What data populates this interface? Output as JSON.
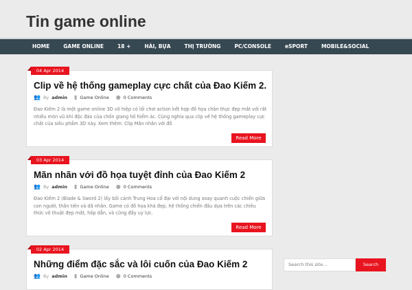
{
  "site_title": "Tin game online",
  "nav": [
    "HOME",
    "GAME ONLINE",
    "18 +",
    "HÀI, BỰA",
    "THỊ TRƯỜNG",
    "PC/CONSOLE",
    "eSPORT",
    "MOBILE&SOCIAL"
  ],
  "posts": [
    {
      "date": "04 Apr 2014",
      "title": "Clip về hệ thống gameplay cực chất của Đao Kiếm 2.",
      "by": "By",
      "author": "admin",
      "category": "Game Online",
      "comments": "0 Comments",
      "excerpt": "Đao Kiếm 2 là một game online 3D võ hiệp có lối chơi action kết hợp đồ họa chân thực đẹp mắt với rất nhiều món vũ khí độc đáo của chốn giang hồ hiểm ác. Cùng nghía qua clip về hệ thống gameplay cực chất của siêu phẩm 3D này. Xem thêm: Clip Mãn nhãn với đồ",
      "read_more": "Read More"
    },
    {
      "date": "03 Apr 2014",
      "title": "Mãn nhãn với đồ họa tuyệt đỉnh của Đao Kiếm 2",
      "by": "By",
      "author": "admin",
      "category": "Game Online",
      "comments": "0 Comments",
      "excerpt": "Đao Kiếm 2 (Blade & Sword 2) lấy bối cảnh Trung Hoa cổ đại với nội dung xoay quanh cuộc chiến giữa con người, thần tiên và dã nhân. Game có đồ họa khá đẹp, hệ thống chiến đấu dựa trên các chiêu thức võ thuật đẹp mắt, hấp dẫn, và cũng đầy uy lực.",
      "read_more": "Read More"
    },
    {
      "date": "02 Apr 2014",
      "title": "Những điểm đặc sắc và lôi cuốn của Đao Kiếm 2",
      "by": "By",
      "author": "admin",
      "category": "Game Online",
      "comments": "0 Comments"
    }
  ],
  "search": {
    "placeholder": "Search this site...",
    "button": "Search"
  }
}
